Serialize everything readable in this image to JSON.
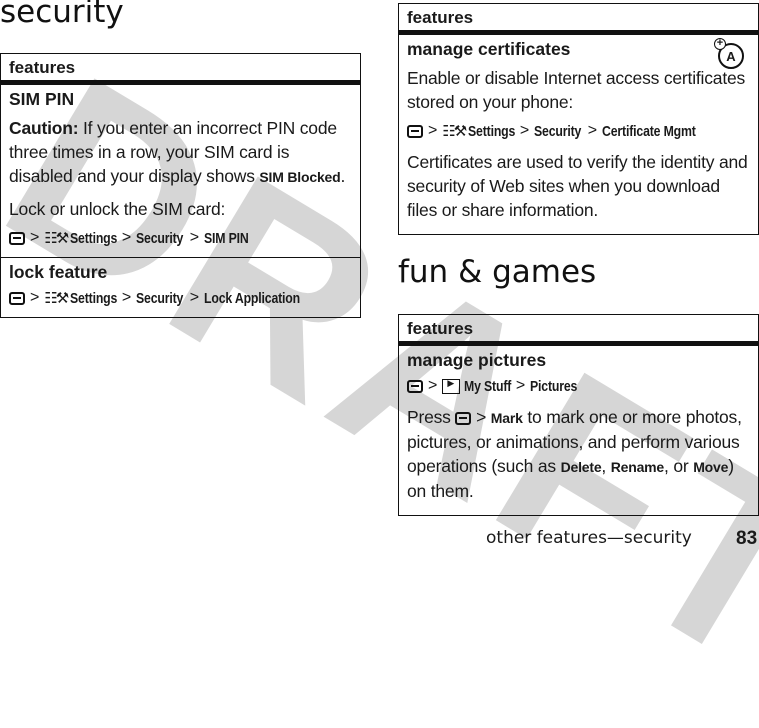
{
  "watermark": "DRAFT",
  "left": {
    "section_title": "security",
    "table": {
      "header": "features",
      "rows": [
        {
          "title": "SIM PIN",
          "caution_label": "Caution:",
          "caution_text": " If you enter an incorrect PIN code three times in a row, your SIM card is disabled and your display shows ",
          "caution_bold": "SIM Blocked",
          "caution_end": ".",
          "instruction": "Lock or unlock the SIM card:",
          "path": [
            "Settings",
            "Security",
            "SIM PIN"
          ]
        },
        {
          "title": "lock feature",
          "path": [
            "Settings",
            "Security",
            "Lock Application"
          ]
        }
      ]
    }
  },
  "right": {
    "table1": {
      "header": "features",
      "row": {
        "title": "manage certificates",
        "icon": "browser-feature-icon",
        "intro": "Enable or disable Internet access certificates stored on your phone:",
        "path": [
          "Settings",
          "Security",
          "Certificate Mgmt"
        ],
        "note": "Certificates are used to verify the identity and security of Web sites when you download files or share information."
      }
    },
    "section_title": "fun & games",
    "table2": {
      "header": "features",
      "row": {
        "title": "manage pictures",
        "path": [
          "My Stuff",
          "Pictures"
        ],
        "press": "Press",
        "mark": "Mark",
        "text1": " to mark one or more photos, pictures, or animations, and perform various operations (such as ",
        "delete": "Delete",
        "comma": ", ",
        "rename": "Rename",
        "or": ", or ",
        "move": "Move",
        "text2": ") on them."
      }
    }
  },
  "footer": {
    "text": "other features—security",
    "page_number": "83"
  },
  "separator": ">",
  "icons": {
    "menu_key": "menu-key-icon",
    "settings": "☷⚒"
  }
}
